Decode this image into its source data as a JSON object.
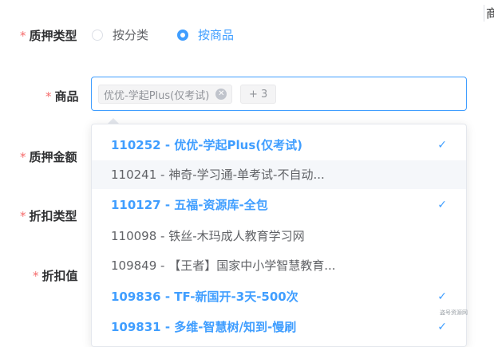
{
  "form": {
    "pledge_type": {
      "required": "*",
      "label": "质押类型"
    },
    "product": {
      "required": "*",
      "label": "商品"
    },
    "pledge_amount": {
      "required": "*",
      "label": "质押金额"
    },
    "discount_type": {
      "required": "*",
      "label": "折扣类型"
    },
    "discount_value": {
      "required": "*",
      "label": "折扣值"
    }
  },
  "radios": [
    {
      "label": "按分类",
      "checked": false
    },
    {
      "label": "按商品",
      "checked": true
    }
  ],
  "select": {
    "tag_label": "优优-学起Plus(仅考试)",
    "more_label": "+ 3"
  },
  "options": [
    {
      "text": "110252 - 优优-学起Plus(仅考试)",
      "selected": true
    },
    {
      "text": "110241 - 神奇-学习通-单考试-不自动...",
      "selected": false,
      "hover": true
    },
    {
      "text": "110127 - 五福-资源库-全包",
      "selected": true
    },
    {
      "text": "110098 - 铁丝-木玛成人教育学习网",
      "selected": false
    },
    {
      "text": "109849 - 【王者】国家中小学智慧教育...",
      "selected": false
    },
    {
      "text": "109836 - TF-新国开-3天-500次",
      "selected": true
    },
    {
      "text": "109831 - 多维-智慧树/知到-慢刷",
      "selected": true
    }
  ],
  "check_glyph": "✓",
  "edge_text": "商",
  "watermark": "盗号资源网",
  "colors": {
    "accent": "#409eff",
    "required": "#f56c6c"
  }
}
